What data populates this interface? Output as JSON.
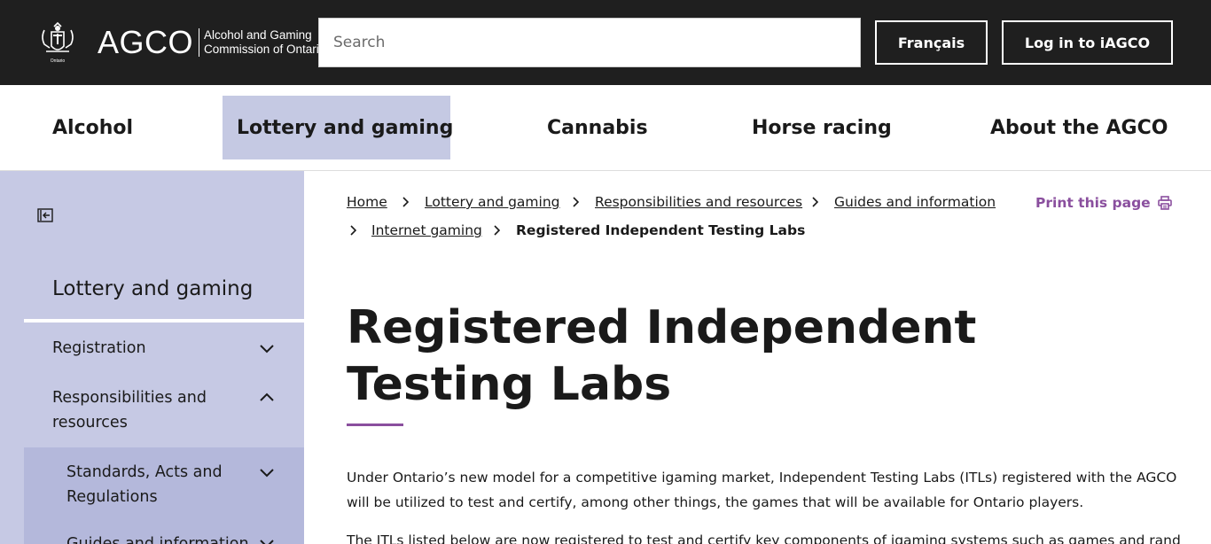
{
  "header": {
    "logo_text": "AGCO",
    "logo_subtitle_line1": "Alcohol and Gaming",
    "logo_subtitle_line2": "Commission of Ontario",
    "search_placeholder": "Search",
    "language_button": "Français",
    "login_button": "Log in to iAGCO"
  },
  "main_nav": {
    "items": [
      {
        "label": "Alcohol",
        "active": false
      },
      {
        "label": "Lottery and gaming",
        "active": true
      },
      {
        "label": "Cannabis",
        "active": false
      },
      {
        "label": "Horse racing",
        "active": false
      },
      {
        "label": "About the AGCO",
        "active": false
      }
    ]
  },
  "sidebar": {
    "title": "Lottery and gaming",
    "items": [
      {
        "label": "Registration",
        "state": "collapsed"
      },
      {
        "label": "Responsibilities and resources",
        "state": "expanded"
      },
      {
        "label": "Standards, Acts and Regulations",
        "state": "collapsed"
      },
      {
        "label": "Guides and information",
        "state": "collapsed"
      }
    ]
  },
  "breadcrumb": {
    "items": [
      "Home",
      "Lottery and gaming",
      "Responsibilities and resources",
      "Guides and information",
      "Internet gaming"
    ],
    "current": "Registered Independent Testing Labs"
  },
  "print_label": "Print this page",
  "page": {
    "title": "Registered Independent Testing Labs",
    "paragraph1": "Under Ontario’s new model for a competitive igaming market, Independent Testing Labs (ITLs) registered with the AGCO will be utilized to test and certify, among other things, the games that will be available for Ontario players.",
    "paragraph2": "The ITLs listed below are now registered to test and certify key components of igaming systems such as games and random"
  },
  "colors": {
    "header_bg": "#1f1f1f",
    "nav_active_bg": "#c5c9e3",
    "sidebar_bg": "#c6c9e4",
    "accent_purple": "#8a4f9e"
  }
}
